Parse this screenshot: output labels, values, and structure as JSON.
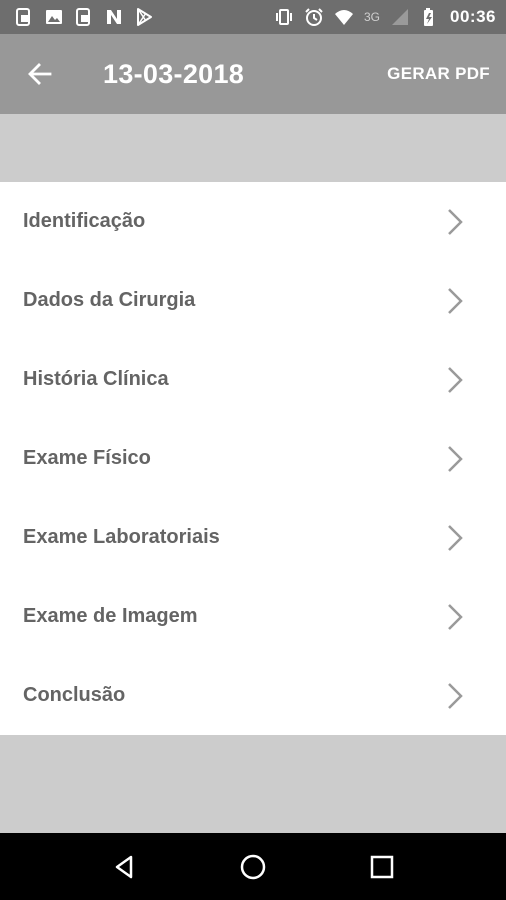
{
  "status_bar": {
    "left_icons": [
      "phone-notification-icon",
      "image-icon",
      "phone-notification-icon",
      "n-app-icon",
      "play-store-icon"
    ],
    "right_icons": [
      "vibrate-icon",
      "alarm-icon",
      "wifi-icon"
    ],
    "network_label": "3G",
    "time": "00:36"
  },
  "app_bar": {
    "title": "13-03-2018",
    "action_label": "GERAR PDF"
  },
  "menu": {
    "items": [
      {
        "label": "Identificação"
      },
      {
        "label": "Dados da Cirurgia"
      },
      {
        "label": "História Clínica"
      },
      {
        "label": "Exame Físico"
      },
      {
        "label": "Exame Laboratoriais"
      },
      {
        "label": "Exame de Imagem"
      },
      {
        "label": "Conclusão"
      }
    ]
  },
  "navigation": {
    "buttons": [
      "back-icon",
      "home-icon",
      "recents-icon"
    ]
  },
  "colors": {
    "status_bar": "#6e6e6e",
    "app_bar": "#989898",
    "background": "#cccccc",
    "list_text": "#646464"
  }
}
